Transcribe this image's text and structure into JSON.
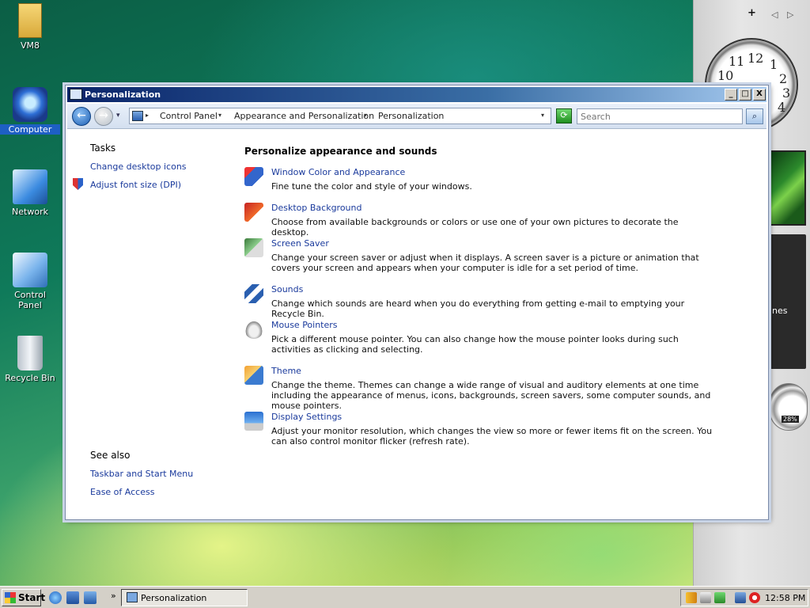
{
  "desktop": {
    "icons": [
      {
        "label": "VM8",
        "icon": "folder-icon"
      },
      {
        "label": "Computer",
        "icon": "computer-icon"
      },
      {
        "label": "Network",
        "icon": "network-icon"
      },
      {
        "label": "Control Panel",
        "icon": "control-panel-icon"
      },
      {
        "label": "Recycle Bin",
        "icon": "recycle-bin-icon"
      }
    ]
  },
  "sidebar": {
    "add_gadget": "+",
    "prev": "◁",
    "next": "▷",
    "clock_numbers": [
      "12",
      "1",
      "2",
      "3",
      "4",
      "10",
      "11"
    ],
    "feed_fragment": "nes",
    "meter_value": "28%"
  },
  "window": {
    "title": "Personalization",
    "buttons": {
      "minimize": "_",
      "maximize": "□",
      "close": "X"
    },
    "nav": {
      "back": "←",
      "forward": "→",
      "dropdown": "▾"
    },
    "breadcrumbs": [
      "Control Panel",
      "Appearance and Personalization",
      "Personalization"
    ],
    "search_placeholder": "Search",
    "refresh": "⟳",
    "search_btn": "⌕"
  },
  "tasks": {
    "heading": "Tasks",
    "links": [
      "Change desktop icons",
      "Adjust font size (DPI)"
    ]
  },
  "see_also": {
    "heading": "See also",
    "links": [
      "Taskbar and Start Menu",
      "Ease of Access"
    ]
  },
  "main": {
    "heading": "Personalize appearance and sounds",
    "items": [
      {
        "title": "Window Color and Appearance",
        "desc": "Fine tune the color and style of your windows.",
        "icon": "window-color-icon"
      },
      {
        "title": "Desktop Background",
        "desc": "Choose from available backgrounds or colors or use one of your own pictures to decorate the desktop.",
        "icon": "desktop-background-icon"
      },
      {
        "title": "Screen Saver",
        "desc": "Change your screen saver or adjust when it displays. A screen saver is a picture or animation that covers your screen and appears when your computer is idle for a set period of time.",
        "icon": "screen-saver-icon"
      },
      {
        "title": "Sounds",
        "desc": "Change which sounds are heard when you do everything from getting e-mail to emptying your Recycle Bin.",
        "icon": "sounds-icon"
      },
      {
        "title": "Mouse Pointers",
        "desc": "Pick a different mouse pointer. You can also change how the mouse pointer looks during such activities as clicking and selecting.",
        "icon": "mouse-pointers-icon"
      },
      {
        "title": "Theme",
        "desc": "Change the theme. Themes can change a wide range of visual and auditory elements at one time including the appearance of menus, icons, backgrounds, screen savers, some computer sounds, and mouse pointers.",
        "icon": "theme-icon"
      },
      {
        "title": "Display Settings",
        "desc": "Adjust your monitor resolution, which changes the view so more or fewer items fit on the screen. You can also control monitor flicker (refresh rate).",
        "icon": "display-settings-icon"
      }
    ]
  },
  "taskbar": {
    "start": "Start",
    "more": "»",
    "task_label": "Personalization",
    "time": "12:58 PM"
  }
}
